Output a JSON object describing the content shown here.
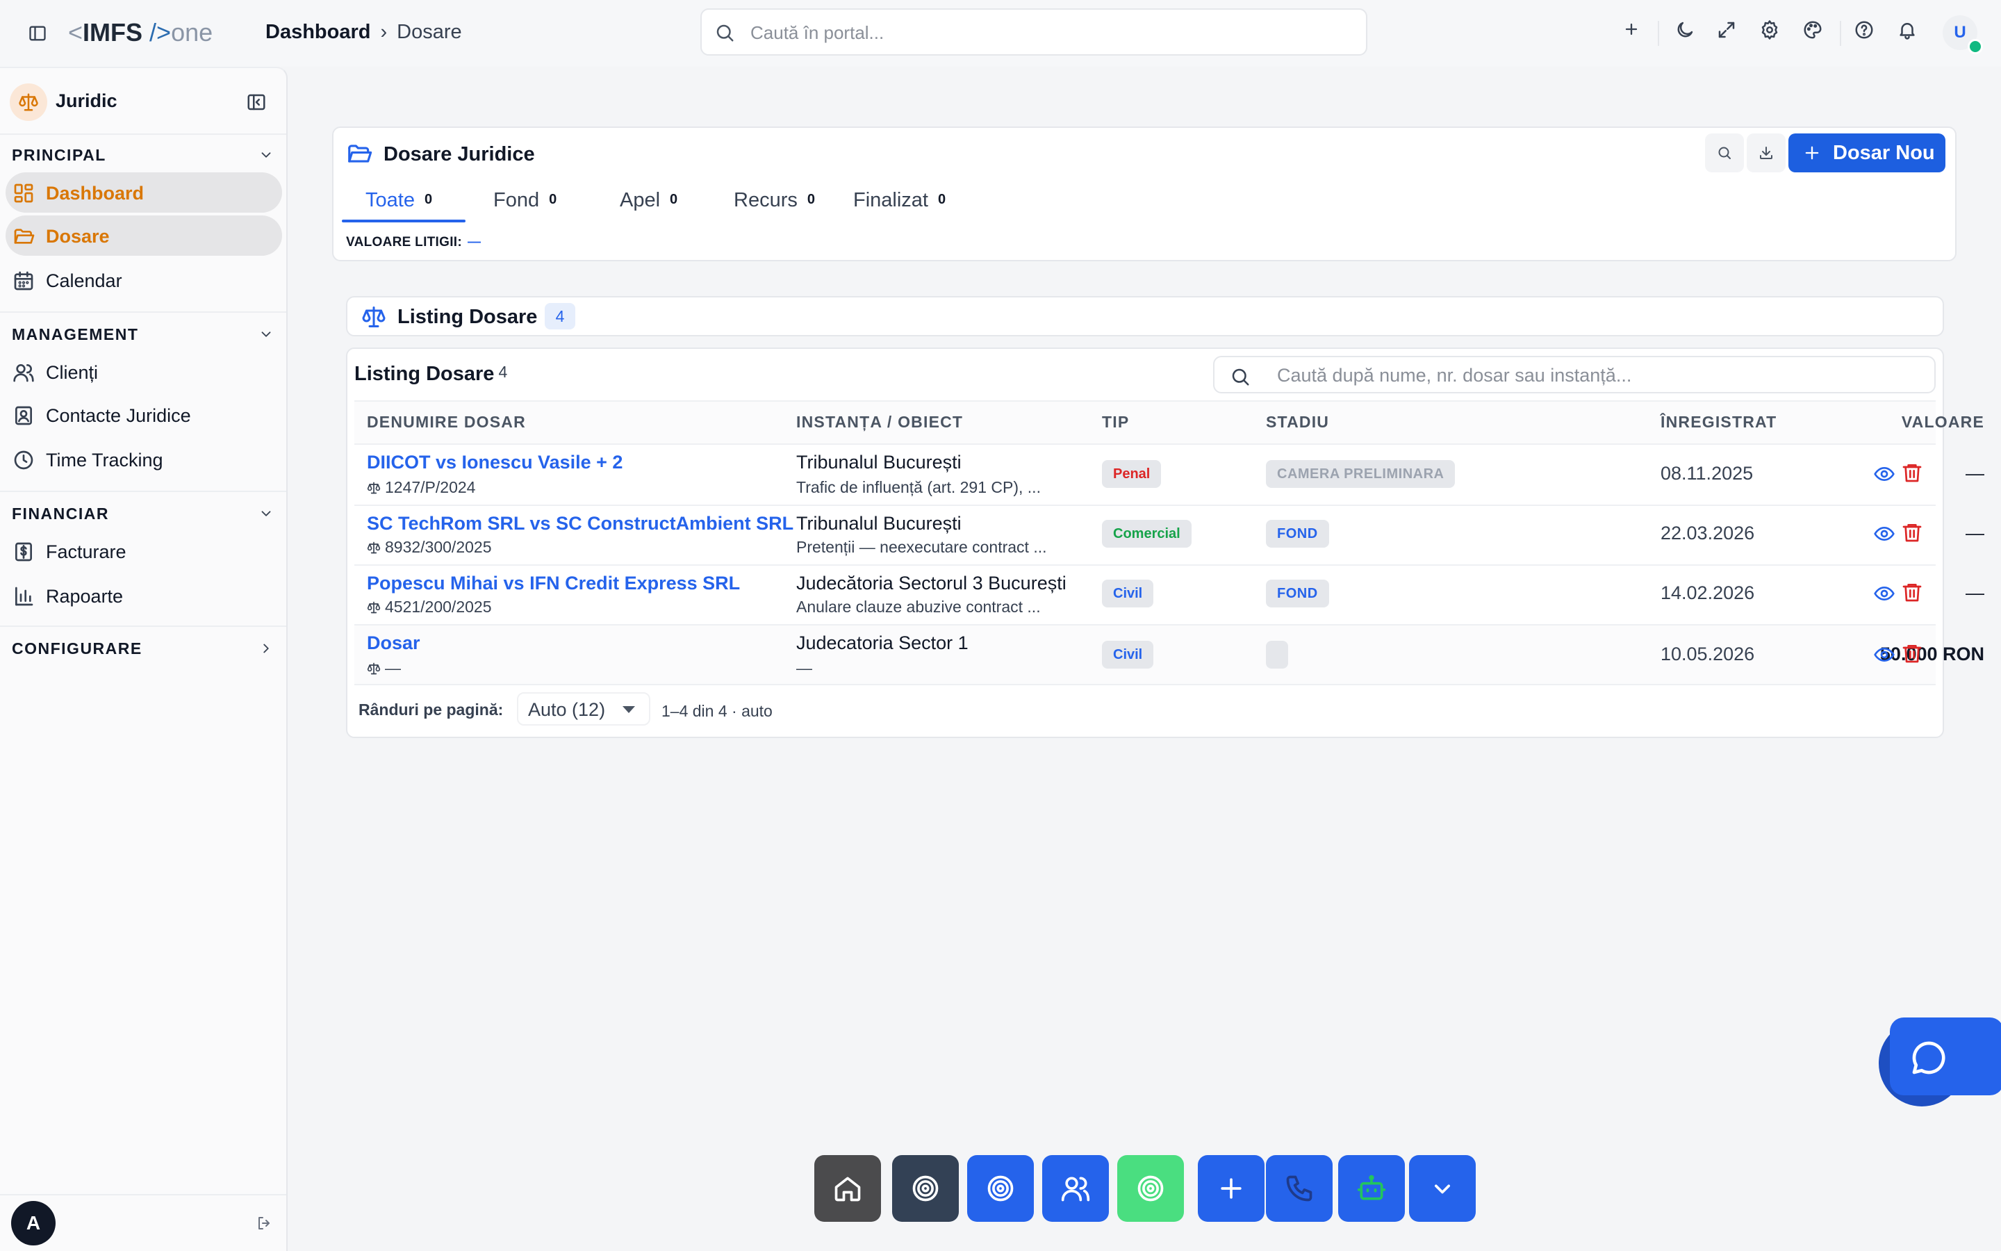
{
  "app": {
    "logo": {
      "open": "<",
      "name": "IMFS",
      "slash": " />",
      "suffix": "one"
    },
    "breadcrumb": {
      "root": "Dashboard",
      "separator": "›",
      "current": "Dosare"
    },
    "search_placeholder": "Caută în portal...",
    "user_initial": "U"
  },
  "sidebar": {
    "title": "Juridic",
    "sections": [
      {
        "label": "PRINCIPAL",
        "expanded": true,
        "items": [
          {
            "label": "Dashboard",
            "icon": "dashboard-icon",
            "active": true
          },
          {
            "label": "Dosare",
            "icon": "folder-icon",
            "active": true
          },
          {
            "label": "Calendar",
            "icon": "calendar-icon",
            "active": false
          }
        ]
      },
      {
        "label": "MANAGEMENT",
        "expanded": true,
        "items": [
          {
            "label": "Clienți",
            "icon": "users-icon"
          },
          {
            "label": "Contacte Juridice",
            "icon": "contact-icon"
          },
          {
            "label": "Time Tracking",
            "icon": "clock-icon"
          }
        ]
      },
      {
        "label": "FINANCIAR",
        "expanded": true,
        "items": [
          {
            "label": "Facturare",
            "icon": "invoice-icon"
          },
          {
            "label": "Rapoarte",
            "icon": "chart-icon"
          }
        ]
      },
      {
        "label": "CONFIGURARE",
        "expanded": false,
        "items": []
      }
    ],
    "footer_user_initial": "A"
  },
  "header_card": {
    "title": "Dosare Juridice",
    "new_button": "Dosar Nou",
    "tabs": [
      {
        "label": "Toate",
        "count": "0",
        "active": true
      },
      {
        "label": "Fond",
        "count": "0"
      },
      {
        "label": "Apel",
        "count": "0"
      },
      {
        "label": "Recurs",
        "count": "0"
      },
      {
        "label": "Finalizat",
        "count": "0"
      }
    ],
    "value_label": "VALOARE LITIGII:",
    "value": "—"
  },
  "listing_header": {
    "title": "Listing Dosare",
    "badge": "4"
  },
  "table": {
    "title": "Listing Dosare",
    "count": "4",
    "search_placeholder": "Caută după nume, nr. dosar sau instanță...",
    "columns": [
      "DENUMIRE DOSAR",
      "INSTANȚA / OBIECT",
      "TIP",
      "STADIU",
      "VALOARE",
      "ÎNREGISTRAT"
    ],
    "rows": [
      {
        "name": "DIICOT vs Ionescu Vasile + 2",
        "number": "1247/P/2024",
        "instance": "Tribunalul București",
        "object": "Trafic de influență (art. 291 CP), ...",
        "type": "Penal",
        "type_color": "#dc2626",
        "stage": "CAMERA PRELIMINARA",
        "stage_color": "#9ca3af",
        "value": "—",
        "registered": "08.11.2025"
      },
      {
        "name": "SC TechRom SRL vs SC ConstructAmbient SRL",
        "number": "8932/300/2025",
        "instance": "Tribunalul București",
        "object": "Pretenții — neexecutare contract ...",
        "type": "Comercial",
        "type_color": "#16a34a",
        "stage": "FOND",
        "stage_color": "#2563eb",
        "value": "—",
        "registered": "22.03.2026"
      },
      {
        "name": "Popescu Mihai vs IFN Credit Express SRL",
        "number": "4521/200/2025",
        "instance": "Judecătoria Sectorul 3 București",
        "object": "Anulare clauze abuzive contract ...",
        "type": "Civil",
        "type_color": "#2563eb",
        "stage": "FOND",
        "stage_color": "#2563eb",
        "value": "—",
        "registered": "14.02.2026"
      },
      {
        "name": "Dosar",
        "number": "—",
        "instance": "Judecatoria Sector 1",
        "object": "—",
        "type": "Civil",
        "type_color": "#2563eb",
        "stage": "",
        "stage_color": "#9ca3af",
        "value": "50.000 RON",
        "registered": "10.05.2026"
      }
    ],
    "pagination": {
      "rows_label": "Rânduri pe pagină:",
      "select_value": "Auto (12)",
      "info": "1–4 din 4 · auto"
    }
  },
  "dock": [
    {
      "icon": "home-icon",
      "color": "#4b4b4d"
    },
    {
      "icon": "target-icon",
      "color": "#334155"
    },
    {
      "icon": "target-icon",
      "color": "#2563eb"
    },
    {
      "icon": "users-icon",
      "color": "#2563eb"
    },
    {
      "icon": "target-icon",
      "color": "#4ade80"
    },
    {
      "icon": "plus-icon",
      "color": "#2563eb"
    },
    {
      "icon": "phone-icon",
      "color": "#2563eb"
    },
    {
      "icon": "bot-icon",
      "color": "#2563eb"
    },
    {
      "icon": "chevron-down-icon",
      "color": "#2563eb"
    }
  ],
  "colors": {
    "accent": "#2563eb",
    "sidebar_active": "#d97706",
    "delete": "#dc2626"
  }
}
